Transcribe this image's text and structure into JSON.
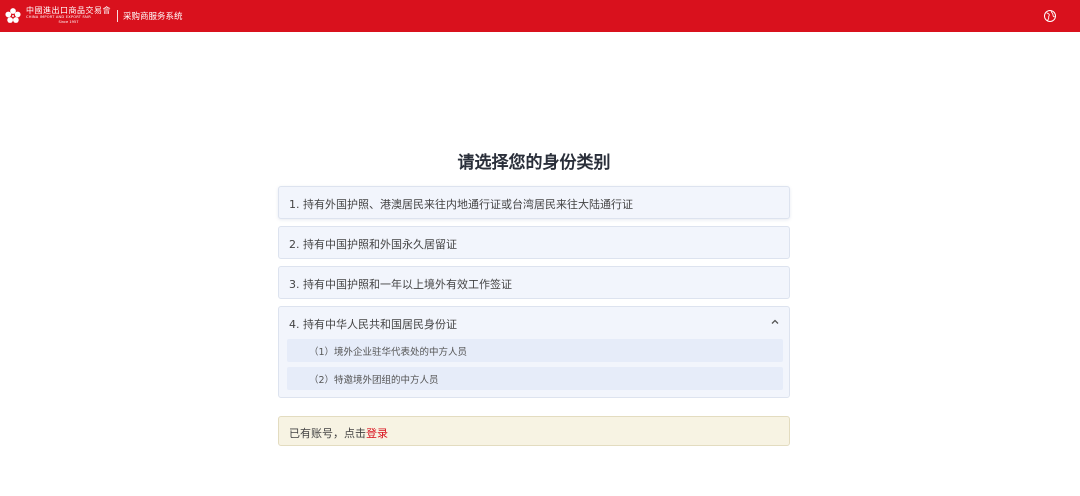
{
  "header": {
    "logo_cn": "中國進出口商品交易會",
    "logo_en": "CHINA IMPORT AND EXPORT FAIR",
    "logo_since": "Since 1957",
    "system_name": "采购商服务系统",
    "language_icon": "globe-icon"
  },
  "main": {
    "title": "请选择您的身份类别",
    "options": [
      {
        "label": "1. 持有外国护照、港澳居民来往内地通行证或台湾居民来往大陆通行证"
      },
      {
        "label": "2. 持有中国护照和外国永久居留证"
      },
      {
        "label": "3. 持有中国护照和一年以上境外有效工作签证"
      },
      {
        "label": "4. 持有中华人民共和国居民身份证",
        "expanded": true,
        "sub_options": [
          {
            "label": "（1）境外企业驻华代表处的中方人员"
          },
          {
            "label": "（2）特邀境外团组的中方人员"
          }
        ]
      }
    ]
  },
  "login_prompt": {
    "text": "已有账号，点击",
    "link": "登录"
  },
  "colors": {
    "brand_red": "#d9111d",
    "option_bg": "#f2f5fc",
    "sub_option_bg": "#e6ecf9",
    "login_bg": "#f7f3e3",
    "link_red": "#d9111d"
  }
}
